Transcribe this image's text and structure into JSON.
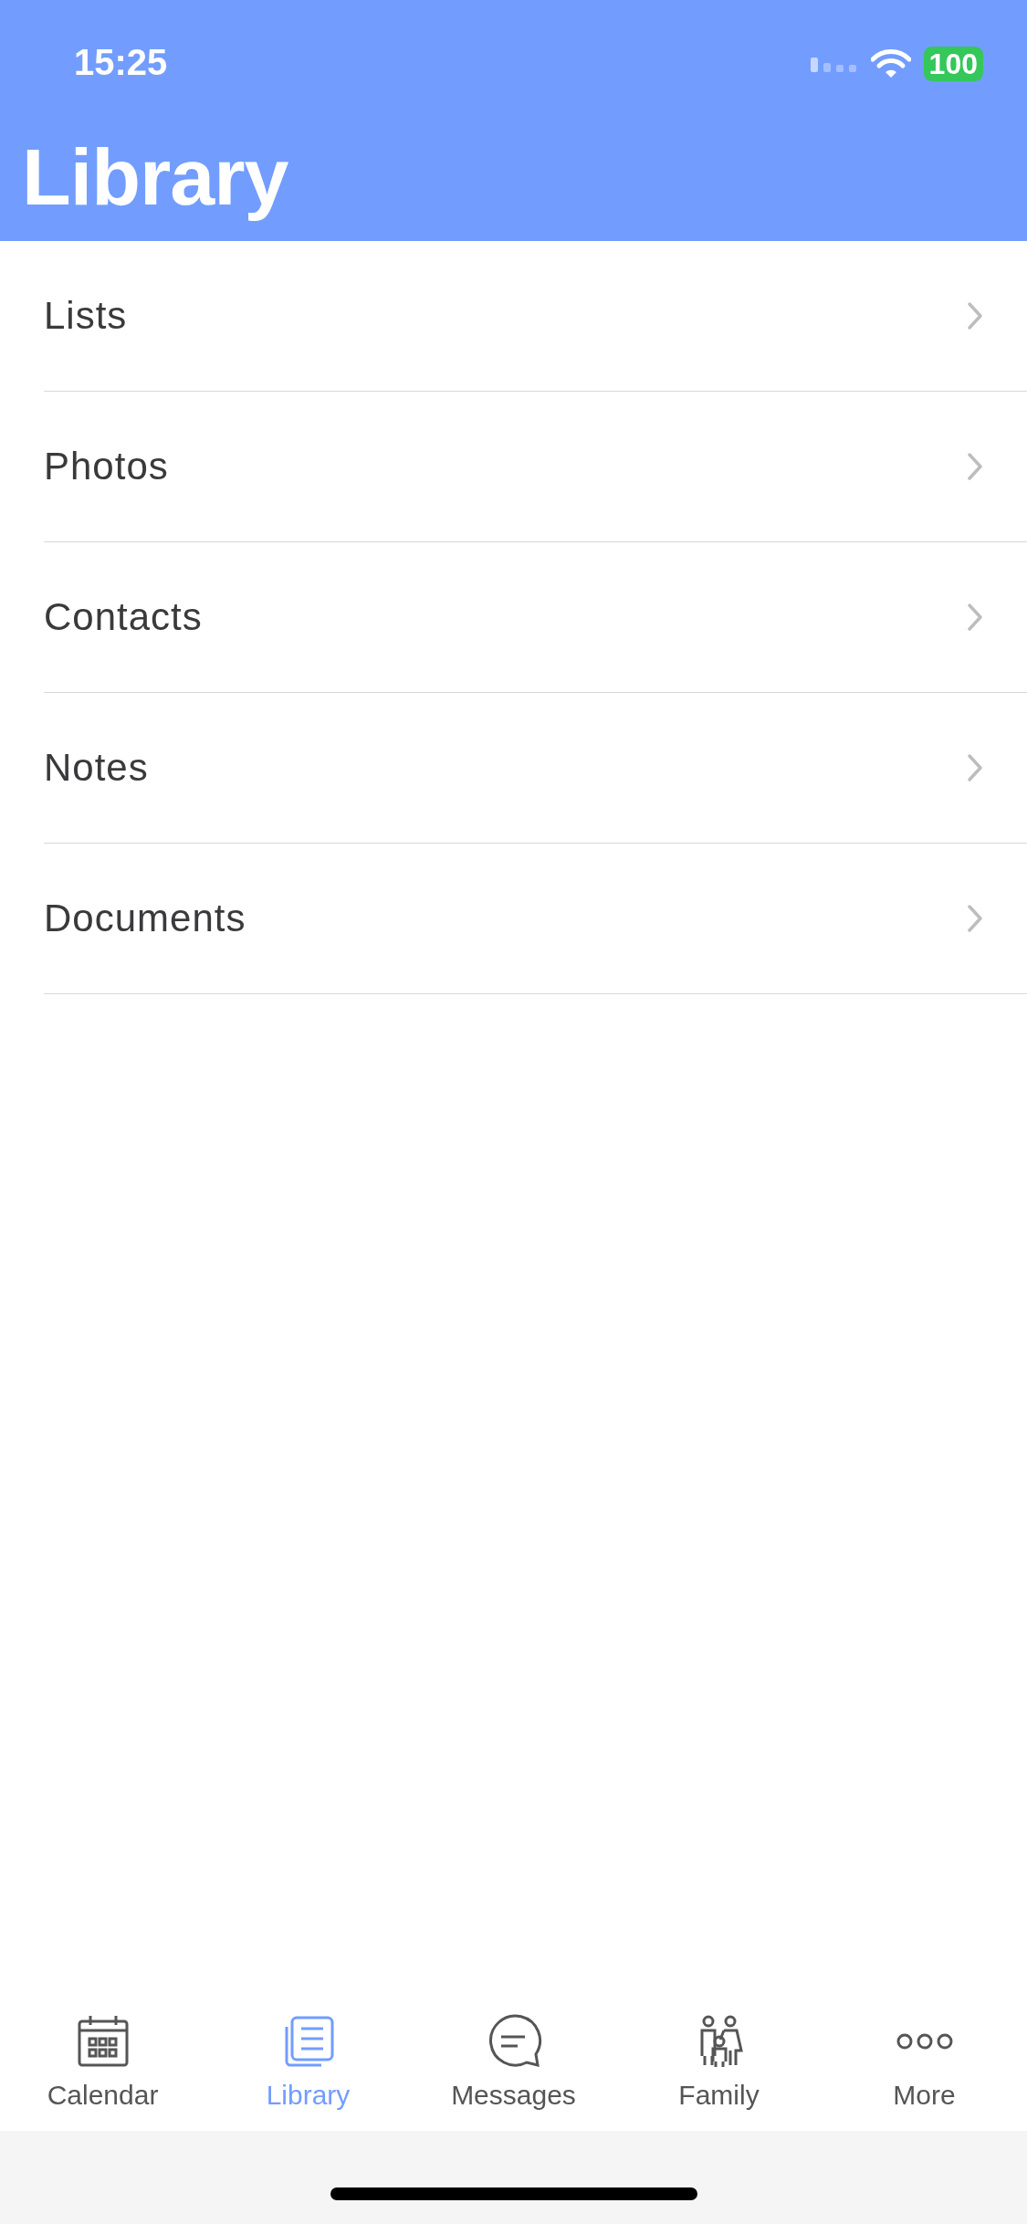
{
  "status_bar": {
    "time": "15:25",
    "battery": "100"
  },
  "header": {
    "title": "Library"
  },
  "list": {
    "items": [
      {
        "label": "Lists"
      },
      {
        "label": "Photos"
      },
      {
        "label": "Contacts"
      },
      {
        "label": "Notes"
      },
      {
        "label": "Documents"
      }
    ]
  },
  "tab_bar": {
    "tabs": [
      {
        "label": "Calendar",
        "selected": false
      },
      {
        "label": "Library",
        "selected": true
      },
      {
        "label": "Messages",
        "selected": false
      },
      {
        "label": "Family",
        "selected": false
      },
      {
        "label": "More",
        "selected": false
      }
    ]
  }
}
